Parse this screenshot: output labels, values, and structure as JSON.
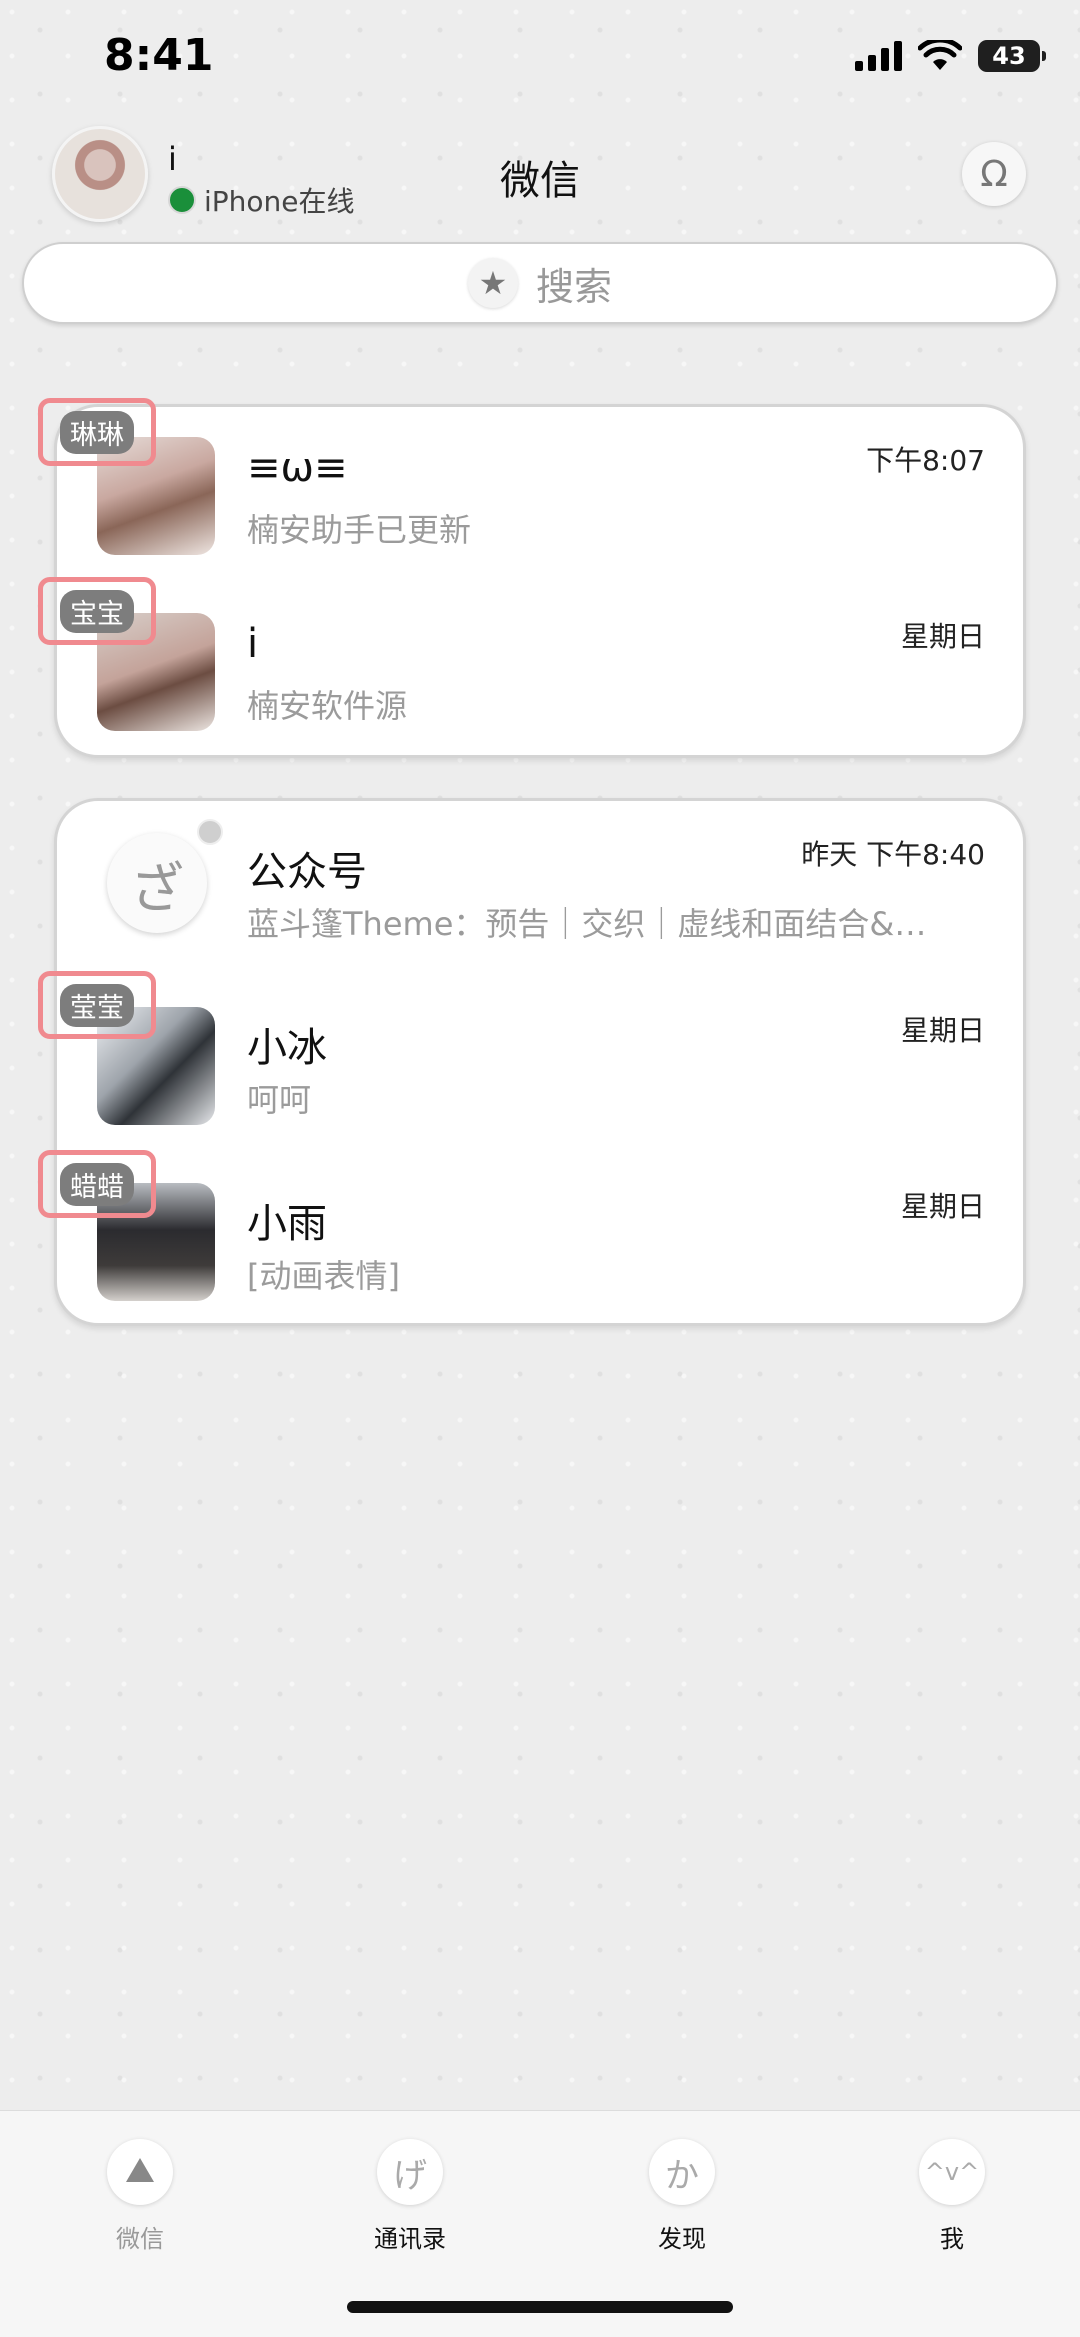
{
  "status_bar": {
    "time": "8:41",
    "battery": "43"
  },
  "header": {
    "profile_name": "i",
    "online_status": "iPhone在线",
    "title": "微信",
    "right_icon": "omega-icon"
  },
  "search": {
    "placeholder": "搜索",
    "icon": "star-icon"
  },
  "chat_groups": [
    {
      "chats": [
        {
          "tag": "琳琳",
          "name": "≡ω≡",
          "preview": "楠安助手已更新",
          "time": "下午8:07"
        },
        {
          "tag": "宝宝",
          "name": "i",
          "preview": "楠安软件源",
          "time": "星期日"
        }
      ]
    },
    {
      "chats": [
        {
          "name": "公众号",
          "avatar_glyph": "ざ",
          "preview": "蓝斗篷Theme：预告｜交织｜虚线和面结合&…",
          "time": "昨天 下午8:40"
        },
        {
          "tag": "莹莹",
          "name": "小冰",
          "preview": "呵呵",
          "time": "星期日"
        },
        {
          "tag": "蜡蜡",
          "name": "小雨",
          "preview": "[动画表情]",
          "time": "星期日"
        }
      ]
    }
  ],
  "tab_bar": [
    {
      "label": "微信",
      "glyph": ""
    },
    {
      "label": "通讯录",
      "glyph": "げ"
    },
    {
      "label": "发现",
      "glyph": "か"
    },
    {
      "label": "我",
      "glyph": "^v^"
    }
  ]
}
